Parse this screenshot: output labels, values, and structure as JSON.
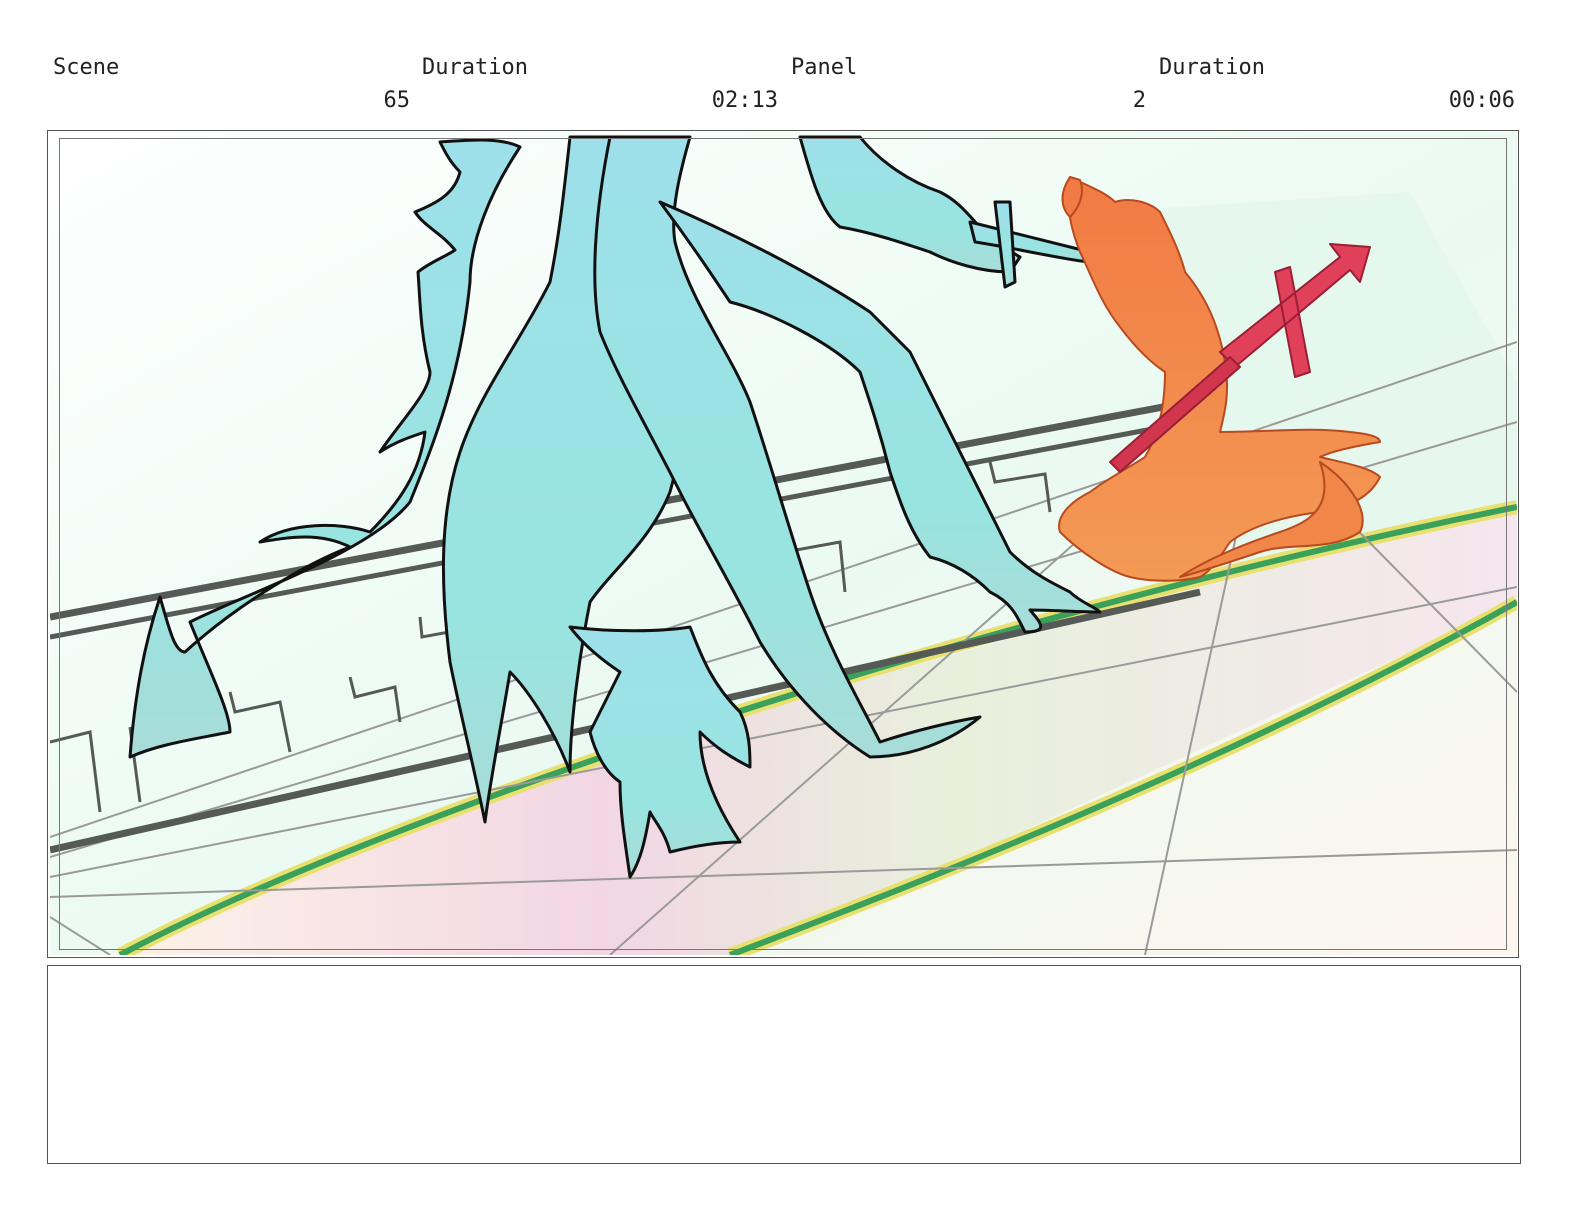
{
  "header": {
    "scene_label": "Scene",
    "scene_duration_label": "Duration",
    "panel_label": "Panel",
    "panel_duration_label": "Duration",
    "scene_number": "65",
    "scene_duration": "02:13",
    "panel_number": "2",
    "panel_duration": "00:06"
  },
  "notes": {
    "text": ""
  },
  "colors": {
    "creature": "#9ee2ea",
    "character": "#f08648",
    "weapon": "#e0405a",
    "rainbow_green": "#3aa05a",
    "rainbow_yellow": "#e8e070"
  }
}
